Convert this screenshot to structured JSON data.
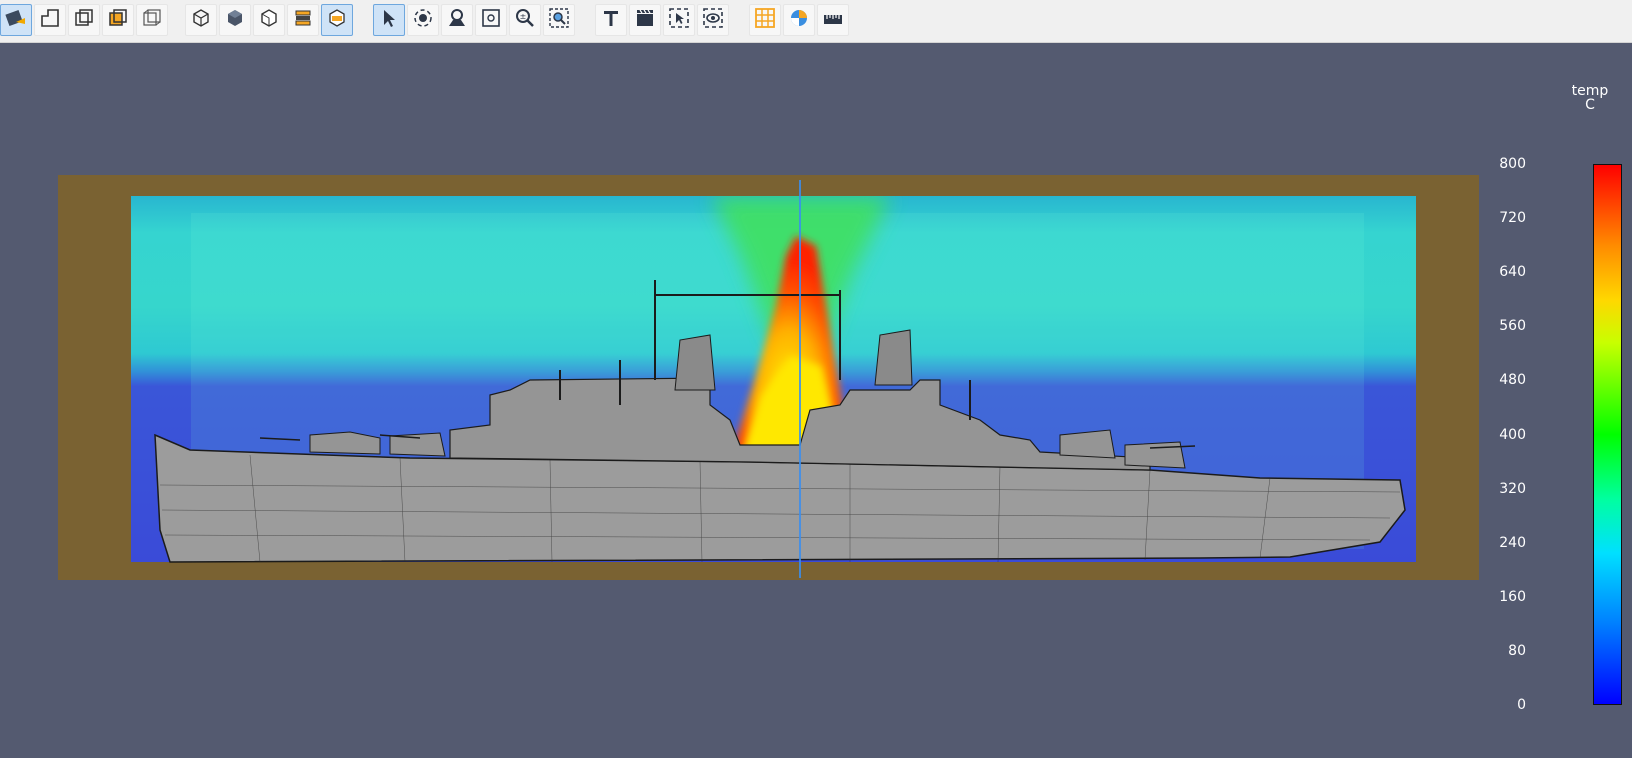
{
  "toolbar": {
    "groups": [
      [
        {
          "name": "surface-render-button",
          "icon": "brush-icon",
          "active": true
        },
        {
          "name": "outline-button",
          "icon": "outline-icon",
          "active": false
        },
        {
          "name": "bounding-box-button",
          "icon": "box-frame-icon",
          "active": false
        },
        {
          "name": "shaded-box-button",
          "icon": "box-orange-icon",
          "active": false
        },
        {
          "name": "wireframe-box-button",
          "icon": "box-wire-icon",
          "active": false
        }
      ],
      [
        {
          "name": "view-iso-button",
          "icon": "cube-iso-icon",
          "active": false
        },
        {
          "name": "view-solid-button",
          "icon": "cube-solid-icon",
          "active": false
        },
        {
          "name": "view-front-button",
          "icon": "cube-front-icon",
          "active": false
        },
        {
          "name": "layers-button",
          "icon": "layers-icon",
          "active": false
        },
        {
          "name": "view-cut-button",
          "icon": "cube-cut-icon",
          "active": true
        }
      ],
      [
        {
          "name": "select-button",
          "icon": "cursor-icon",
          "active": true
        },
        {
          "name": "rotate-button",
          "icon": "rotate-icon",
          "active": false
        },
        {
          "name": "camera-button",
          "icon": "camera-eye-icon",
          "active": false
        },
        {
          "name": "fit-button",
          "icon": "fit-icon",
          "active": false
        },
        {
          "name": "zoom-button",
          "icon": "zoom-icon",
          "active": false
        },
        {
          "name": "zoom-box-button",
          "icon": "zoom-box-icon",
          "active": false
        }
      ],
      [
        {
          "name": "text-button",
          "icon": "text-icon",
          "active": false
        },
        {
          "name": "clapper-button",
          "icon": "clapper-icon",
          "active": false
        },
        {
          "name": "select-box-button",
          "icon": "select-box-icon",
          "active": false
        },
        {
          "name": "visibility-button",
          "icon": "eye-box-icon",
          "active": false
        }
      ],
      [
        {
          "name": "grid-button",
          "icon": "grid-icon",
          "active": false
        },
        {
          "name": "color-button",
          "icon": "color-globe-icon",
          "active": false
        },
        {
          "name": "ruler-button",
          "icon": "ruler-icon",
          "active": false
        }
      ]
    ]
  },
  "legend": {
    "title": "temp",
    "unit": "C",
    "ticks": [
      "800",
      "720",
      "640",
      "560",
      "480",
      "400",
      "320",
      "240",
      "160",
      "80",
      "0"
    ],
    "min": 0,
    "max": 800
  },
  "colors": {
    "background": "#545a70",
    "domain": "#7a6232",
    "ship": "#9a9a9a"
  }
}
